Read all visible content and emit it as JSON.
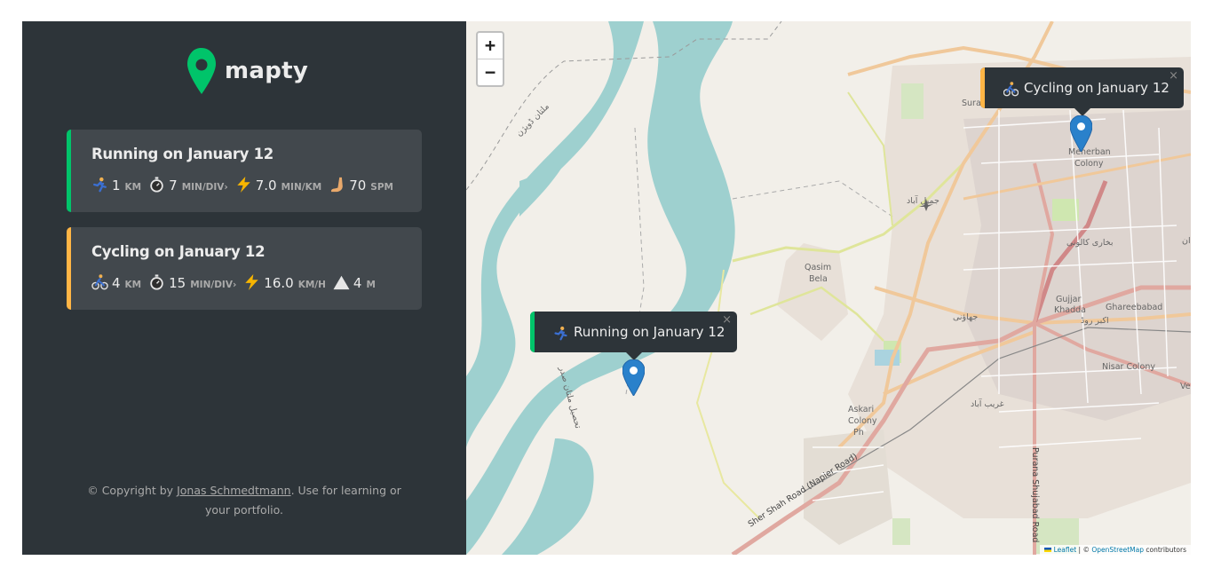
{
  "app": {
    "name": "mapty"
  },
  "workouts": [
    {
      "type": "running",
      "title": "Running on January 12",
      "color": "#00c46a",
      "details": [
        {
          "icon": "running-icon",
          "value": "1",
          "unit": "KM"
        },
        {
          "icon": "stopwatch-icon",
          "value": "7",
          "unit": "MIN/div›"
        },
        {
          "icon": "lightning-icon",
          "value": "7.0",
          "unit": "MIN/KM"
        },
        {
          "icon": "foot-icon",
          "value": "70",
          "unit": "SPM"
        }
      ]
    },
    {
      "type": "cycling",
      "title": "Cycling on January 12",
      "color": "#ffb545",
      "details": [
        {
          "icon": "cycling-icon",
          "value": "4",
          "unit": "KM"
        },
        {
          "icon": "stopwatch-icon",
          "value": "15",
          "unit": "MIN/div›"
        },
        {
          "icon": "lightning-icon",
          "value": "16.0",
          "unit": "KM/H"
        },
        {
          "icon": "mountain-icon",
          "value": "4",
          "unit": "M"
        }
      ]
    }
  ],
  "copyright": {
    "prefix": "© Copyright by ",
    "author": "Jonas Schmedtmann",
    "suffix": ". Use for learning or your portfolio."
  },
  "map": {
    "zoom_in": "+",
    "zoom_out": "−",
    "popups": [
      {
        "text": "Running on January 12",
        "color": "#00c46a",
        "icon": "running-icon",
        "close": "×"
      },
      {
        "text": "Cycling on January 12",
        "color": "#ffb545",
        "icon": "cycling-icon",
        "close": "×"
      }
    ],
    "labels": {
      "sura": "Sura",
      "meherban": "Meherban",
      "colony": "Colony",
      "qasim": "Qasim",
      "bela": "Bela",
      "gujjar": "Gujjar",
      "khadda": "Khadda",
      "ghareebabad": "Ghareebabad",
      "nisar": "Nisar Colony",
      "askari": "Askari",
      "askari_colony": "Colony",
      "phase": "Ph",
      "sher_shah": "Sher Shah Road (Napier Road)",
      "purana": "Purana Shujabad Road",
      "ve": "Ve",
      "ar_1": "ملتان ڈویژن",
      "ar_2": "جمیل آباد",
      "ar_3": "بخاری کالونی",
      "ar_4": "جھاؤنی",
      "ar_5": "اکبر روڈ",
      "ar_6": "غریب آباد",
      "ar_7": "تحصیل ملتان صدر",
      "ar_8": "ان"
    },
    "attribution": {
      "leaflet": "Leaflet",
      "sep": " | © ",
      "osm": "OpenStreetMap",
      "suffix": " contributors"
    }
  },
  "colors": {
    "sidebar_bg": "#2d3439",
    "card_bg": "#42484d",
    "running": "#00c46a",
    "cycling": "#ffb545",
    "marker": "#2a81cb",
    "river": "#9ed0cf"
  }
}
